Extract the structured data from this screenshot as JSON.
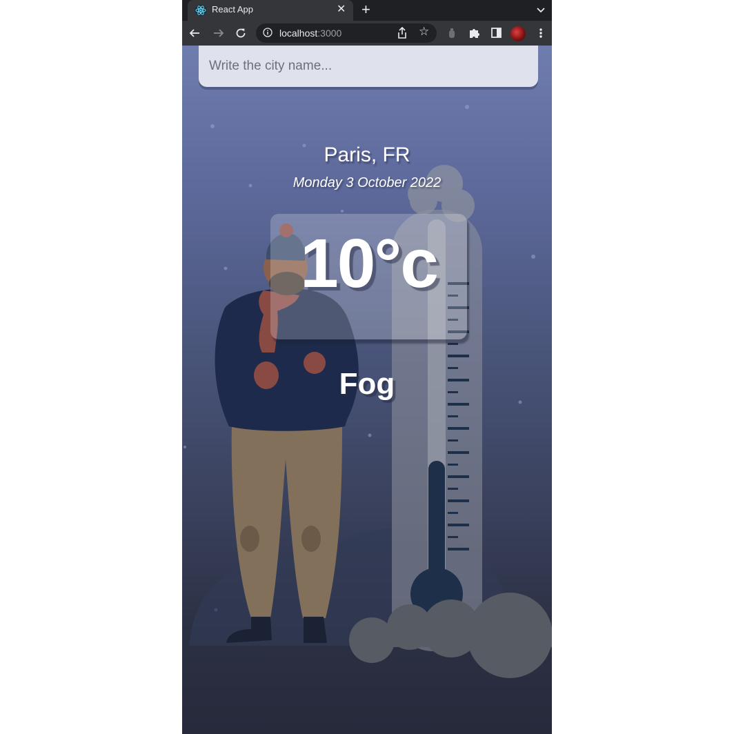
{
  "browser": {
    "tab_title": "React App",
    "url_host": "localhost",
    "url_port": ":3000"
  },
  "search": {
    "placeholder": "Write the city name..."
  },
  "weather": {
    "location": "Paris, FR",
    "date": "Monday 3 October 2022",
    "temperature": "10°c",
    "condition": "Fog"
  },
  "colors": {
    "accent_text": "#ffffff",
    "search_bg": "#dfe1ec",
    "bg_top": "#6f7cae",
    "bg_bottom": "#262a3b"
  }
}
